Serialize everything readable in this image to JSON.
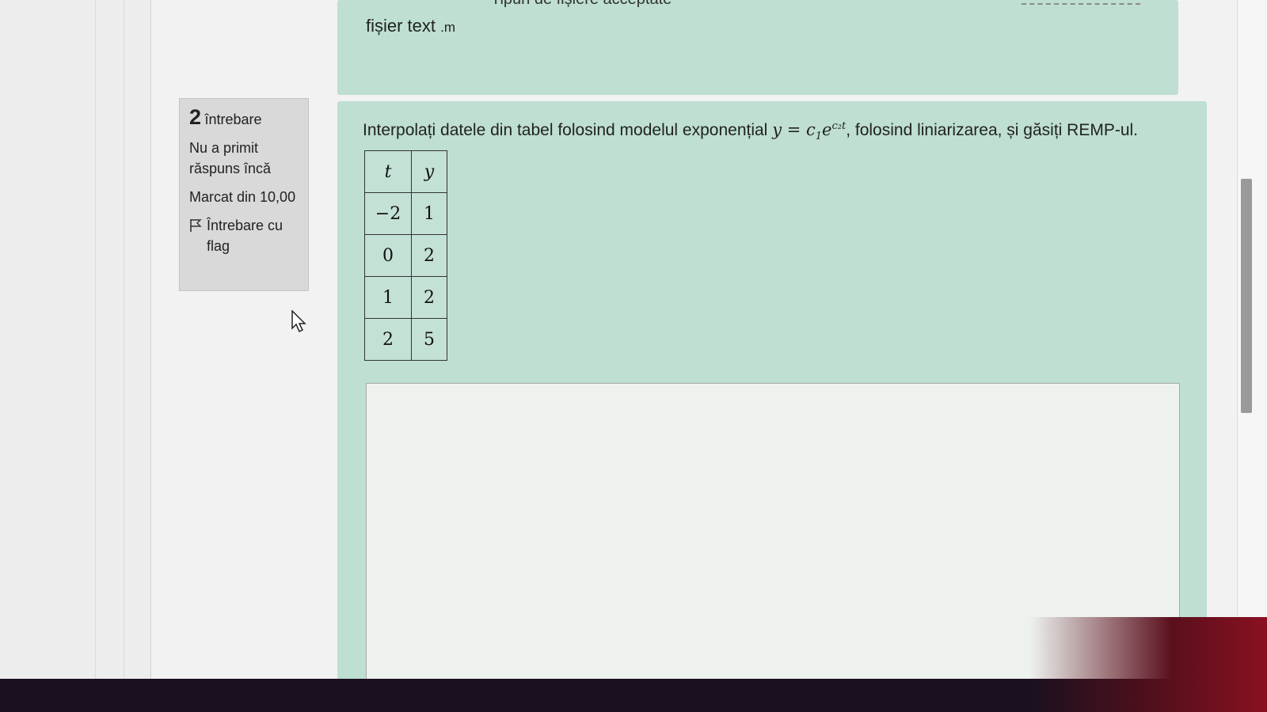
{
  "previous_question": {
    "cut_heading": "Tipuri de fișiere acceptate",
    "file_type": "fișier text",
    "file_ext": ".m"
  },
  "question_info": {
    "number": "2",
    "label": "întrebare",
    "status": "Nu a primit răspuns încă",
    "marks": "Marcat din 10,00",
    "flag_label": "Întrebare cu flag"
  },
  "question": {
    "text_before": "Interpolați datele din tabel folosind modelul exponențial ",
    "formula_lhs": "y = c",
    "formula_sub": "1",
    "formula_base": "e",
    "formula_sup": "c₂t",
    "text_after": ", folosind liniarizarea, și găsiți REMP-ul."
  },
  "table": {
    "headers": [
      "t",
      "y"
    ],
    "rows": [
      [
        "−2",
        "1"
      ],
      [
        "0",
        "2"
      ],
      [
        "1",
        "2"
      ],
      [
        "2",
        "5"
      ]
    ]
  },
  "answer": {
    "value": ""
  },
  "colors": {
    "panel_bg": "#bedfd1",
    "info_bg": "#d9d9d9"
  }
}
